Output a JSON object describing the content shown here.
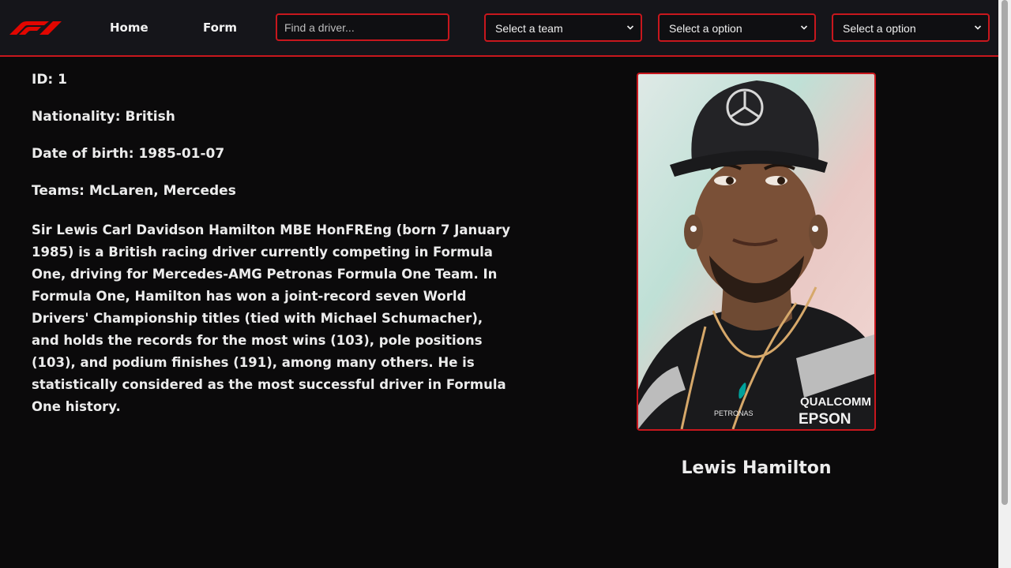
{
  "nav": {
    "logo_icon": "f1-logo-icon",
    "home_label": "Home",
    "form_label": "Form",
    "search_placeholder": "Find a driver...",
    "team_select": "Select a team",
    "option_select_1": "Select a option",
    "option_select_2": "Select a option"
  },
  "driver": {
    "id_line": "ID: 1",
    "nationality_line": "Nationality: British",
    "dob_line": "Date of birth: 1985-01-07",
    "teams_line": "Teams: McLaren, Mercedes",
    "bio": "Sir Lewis Carl Davidson Hamilton MBE HonFREng (born 7 January 1985) is a British racing driver currently competing in Formula One, driving for Mercedes-AMG Petronas Formula One Team. In Formula One, Hamilton has won a joint-record seven World Drivers' Championship titles (tied with Michael Schumacher), and holds the records for the most wins (103), pole positions (103), and podium finishes (191), among many others. He is statistically considered as the most successful driver in Formula One history.",
    "name": "Lewis Hamilton",
    "photo_sponsor_1": "QUALCOMM",
    "photo_sponsor_2": "EPSON",
    "photo_sponsor_3": "PETRONAS"
  },
  "colors": {
    "accent": "#c8171d",
    "background": "#0b0a0b",
    "navbar": "#15151a"
  }
}
